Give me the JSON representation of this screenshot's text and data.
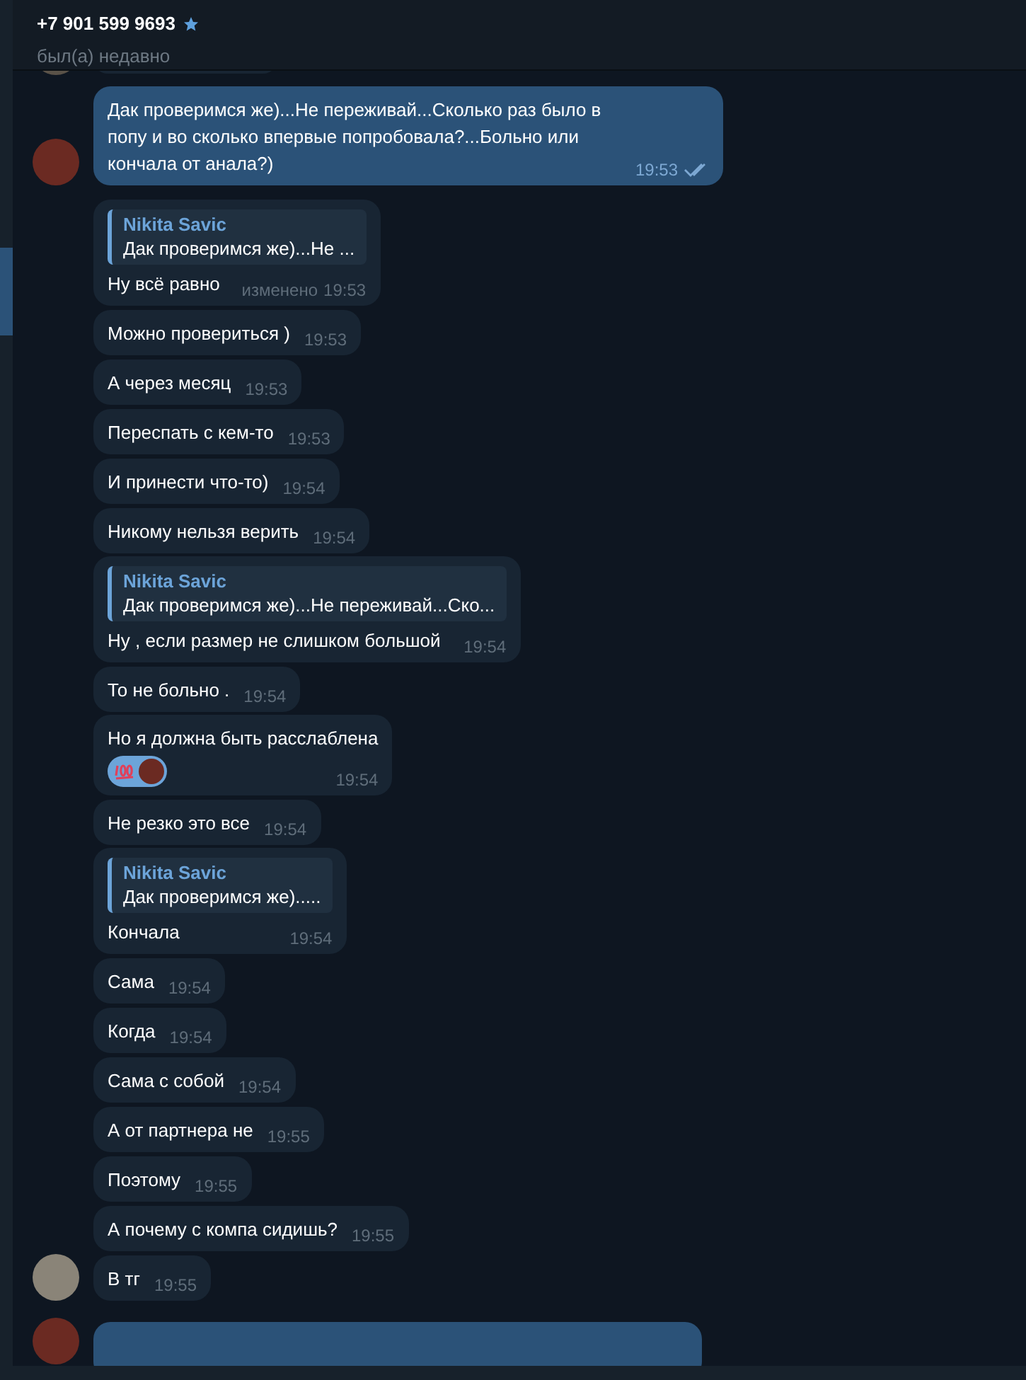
{
  "header": {
    "title": "+7 901 599 9693",
    "starred": true,
    "status": "был(а) недавно"
  },
  "messages": [
    {
      "outgoing": true,
      "avatar": true,
      "text": "Дак проверимся же)...Не переживай...Сколько раз было в попу и во сколько впервые попробовала?...Больно или кончала от анала?)",
      "time": "19:53",
      "read": true
    },
    {
      "outgoing": false,
      "avatar": false,
      "reply": {
        "author": "Nikita Savic",
        "text": "Дак проверимся же)...Не ..."
      },
      "text": "Ну всё равно",
      "edited": "изменено",
      "time": "19:53"
    },
    {
      "outgoing": false,
      "avatar": false,
      "text": "Можно провериться )",
      "time": "19:53"
    },
    {
      "outgoing": false,
      "avatar": false,
      "text": "А через месяц",
      "time": "19:53"
    },
    {
      "outgoing": false,
      "avatar": false,
      "text": "Переспать с кем-то",
      "time": "19:53"
    },
    {
      "outgoing": false,
      "avatar": false,
      "text": "И принести что-то)",
      "time": "19:54"
    },
    {
      "outgoing": false,
      "avatar": false,
      "text": "Никому нельзя верить",
      "time": "19:54"
    },
    {
      "outgoing": false,
      "avatar": false,
      "reply": {
        "author": "Nikita Savic",
        "text": "Дак проверимся же)...Не переживай...Ско..."
      },
      "text": "Ну , если размер не слишком большой",
      "time": "19:54"
    },
    {
      "outgoing": false,
      "avatar": false,
      "text": "То не больно .",
      "time": "19:54"
    },
    {
      "outgoing": false,
      "avatar": false,
      "text": "Но я должна быть расслаблена",
      "time": "19:54",
      "reacted": true
    },
    {
      "outgoing": false,
      "avatar": false,
      "text": "Не резко это все",
      "time": "19:54"
    },
    {
      "outgoing": false,
      "avatar": false,
      "reply": {
        "author": "Nikita Savic",
        "text": "Дак проверимся же)....."
      },
      "text": "Кончала",
      "time": "19:54"
    },
    {
      "outgoing": false,
      "avatar": false,
      "text": "Сама",
      "time": "19:54"
    },
    {
      "outgoing": false,
      "avatar": false,
      "text": "Когда",
      "time": "19:54"
    },
    {
      "outgoing": false,
      "avatar": false,
      "text": "Сама с собой",
      "time": "19:54"
    },
    {
      "outgoing": false,
      "avatar": false,
      "text": "А от партнера не",
      "time": "19:55"
    },
    {
      "outgoing": false,
      "avatar": false,
      "text": "Поэтому",
      "time": "19:55"
    },
    {
      "outgoing": false,
      "avatar": false,
      "text": "А почему с компа сидишь?",
      "time": "19:55"
    },
    {
      "outgoing": false,
      "avatar": true,
      "text": "В тг",
      "time": "19:55"
    }
  ]
}
